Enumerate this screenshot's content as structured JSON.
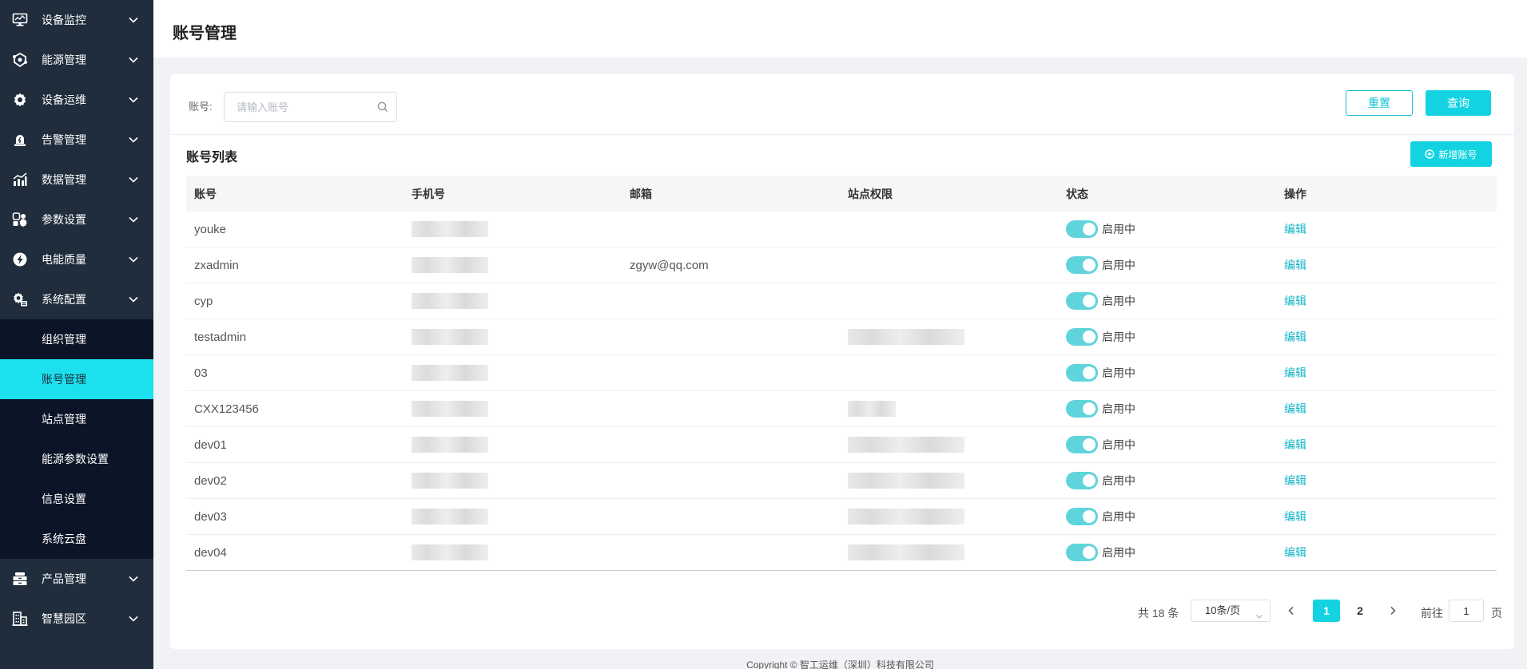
{
  "sidebar": {
    "menu_top": [
      {
        "label": "设备监控",
        "icon": "monitor-icon"
      },
      {
        "label": "能源管理",
        "icon": "energy-icon"
      },
      {
        "label": "设备运维",
        "icon": "gear-icon"
      },
      {
        "label": "告警管理",
        "icon": "alarm-icon"
      },
      {
        "label": "数据管理",
        "icon": "chart-icon"
      },
      {
        "label": "参数设置",
        "icon": "settings-icon"
      },
      {
        "label": "电能质量",
        "icon": "lightning-icon"
      },
      {
        "label": "系统配置",
        "icon": "system-config-icon"
      }
    ],
    "submenu": [
      {
        "label": "组织管理",
        "active": false
      },
      {
        "label": "账号管理",
        "active": true
      },
      {
        "label": "站点管理",
        "active": false
      },
      {
        "label": "能源参数设置",
        "active": false
      },
      {
        "label": "信息设置",
        "active": false
      },
      {
        "label": "系统云盘",
        "active": false
      }
    ],
    "menu_bottom": [
      {
        "label": "产品管理",
        "icon": "product-icon"
      },
      {
        "label": "智慧园区",
        "icon": "building-icon"
      }
    ]
  },
  "header": {
    "title": "账号管理"
  },
  "filter": {
    "label": "账号:",
    "placeholder": "请输入账号",
    "reset_label": "重置",
    "query_label": "查询"
  },
  "list": {
    "title": "账号列表",
    "add_label": "新增账号"
  },
  "table": {
    "columns": [
      "账号",
      "手机号",
      "邮箱",
      "站点权限",
      "状态",
      "操作"
    ],
    "rows": [
      {
        "account": "youke",
        "email": "",
        "site": "none",
        "status": "启用中",
        "action": "编辑"
      },
      {
        "account": "zxadmin",
        "email": "zgyw@qq.com",
        "site": "none",
        "status": "启用中",
        "action": "编辑"
      },
      {
        "account": "cyp",
        "email": "",
        "site": "none",
        "status": "启用中",
        "action": "编辑"
      },
      {
        "account": "testadmin",
        "email": "",
        "site": "long",
        "status": "启用中",
        "action": "编辑"
      },
      {
        "account": "03",
        "email": "",
        "site": "none",
        "status": "启用中",
        "action": "编辑"
      },
      {
        "account": "CXX123456",
        "email": "",
        "site": "short",
        "status": "启用中",
        "action": "编辑"
      },
      {
        "account": "dev01",
        "email": "",
        "site": "long",
        "status": "启用中",
        "action": "编辑"
      },
      {
        "account": "dev02",
        "email": "",
        "site": "long",
        "status": "启用中",
        "action": "编辑"
      },
      {
        "account": "dev03",
        "email": "",
        "site": "long",
        "status": "启用中",
        "action": "编辑"
      },
      {
        "account": "dev04",
        "email": "",
        "site": "long",
        "status": "启用中",
        "action": "编辑"
      }
    ]
  },
  "pagination": {
    "total": "共 18 条",
    "page_size": "10条/页",
    "pages": [
      "1",
      "2"
    ],
    "current": "1",
    "goto_label": "前往",
    "goto_value": "1",
    "page_suffix": "页"
  },
  "footer": {
    "copyright": "Copyright © 智工运维（深圳）科技有限公司"
  },
  "colors": {
    "accent": "#13d3e2",
    "sidebar": "#1f2d3d",
    "submenu": "#0c1528",
    "active": "#1de0ef"
  }
}
